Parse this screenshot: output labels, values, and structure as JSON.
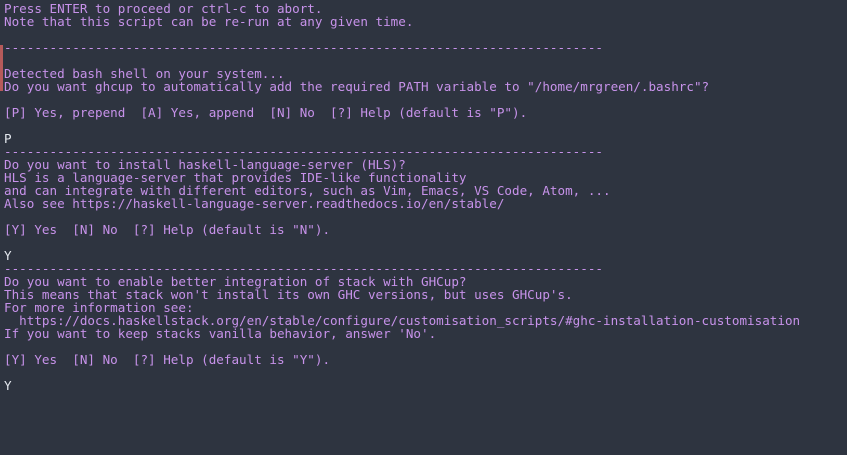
{
  "terminal": {
    "colors": {
      "background": "#2e3440",
      "output_text": "#c792ea",
      "input_text": "#e5e9f0",
      "left_marker": "#b65a5a"
    },
    "lines": [
      {
        "text": "Press ENTER to proceed or ctrl-c to abort.",
        "kind": "output"
      },
      {
        "text": "Note that this script can be re-run at any given time.",
        "kind": "output"
      },
      {
        "text": "",
        "kind": "blank"
      },
      {
        "text": "-------------------------------------------------------------------------------",
        "kind": "sep"
      },
      {
        "text": "",
        "kind": "blank"
      },
      {
        "text": "Detected bash shell on your system...",
        "kind": "output"
      },
      {
        "text": "Do you want ghcup to automatically add the required PATH variable to \"/home/mrgreen/.bashrc\"?",
        "kind": "output"
      },
      {
        "text": "",
        "kind": "blank"
      },
      {
        "text": "[P] Yes, prepend  [A] Yes, append  [N] No  [?] Help (default is \"P\").",
        "kind": "output"
      },
      {
        "text": "",
        "kind": "blank"
      },
      {
        "text": "P",
        "kind": "input"
      },
      {
        "text": "-------------------------------------------------------------------------------",
        "kind": "sep"
      },
      {
        "text": "Do you want to install haskell-language-server (HLS)?",
        "kind": "output"
      },
      {
        "text": "HLS is a language-server that provides IDE-like functionality",
        "kind": "output"
      },
      {
        "text": "and can integrate with different editors, such as Vim, Emacs, VS Code, Atom, ...",
        "kind": "output"
      },
      {
        "text": "Also see https://haskell-language-server.readthedocs.io/en/stable/",
        "kind": "output"
      },
      {
        "text": "",
        "kind": "blank"
      },
      {
        "text": "[Y] Yes  [N] No  [?] Help (default is \"N\").",
        "kind": "output"
      },
      {
        "text": "",
        "kind": "blank"
      },
      {
        "text": "Y",
        "kind": "input"
      },
      {
        "text": "-------------------------------------------------------------------------------",
        "kind": "sep"
      },
      {
        "text": "Do you want to enable better integration of stack with GHCup?",
        "kind": "output"
      },
      {
        "text": "This means that stack won't install its own GHC versions, but uses GHCup's.",
        "kind": "output"
      },
      {
        "text": "For more information see:",
        "kind": "output"
      },
      {
        "text": "  https://docs.haskellstack.org/en/stable/configure/customisation_scripts/#ghc-installation-customisation",
        "kind": "output"
      },
      {
        "text": "If you want to keep stacks vanilla behavior, answer 'No'.",
        "kind": "output"
      },
      {
        "text": "",
        "kind": "blank"
      },
      {
        "text": "[Y] Yes  [N] No  [?] Help (default is \"Y\").",
        "kind": "output"
      },
      {
        "text": "",
        "kind": "blank"
      },
      {
        "text": "Y",
        "kind": "input"
      }
    ]
  }
}
